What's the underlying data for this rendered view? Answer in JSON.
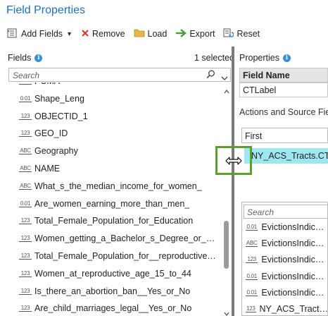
{
  "window": {
    "title": "Field Properties"
  },
  "toolbar": {
    "add_fields": "Add Fields",
    "remove": "Remove",
    "load": "Load",
    "export": "Export",
    "reset": "Reset"
  },
  "fields_panel": {
    "label": "Fields",
    "selected": "1 selected",
    "search_placeholder": "Search",
    "items": [
      {
        "type": "ABC",
        "name": "PUMA"
      },
      {
        "type": "0.01",
        "name": "Shape_Leng"
      },
      {
        "type": "123",
        "name": "OBJECTID_1"
      },
      {
        "type": "123",
        "name": "GEO_ID"
      },
      {
        "type": "ABC",
        "name": "Geography"
      },
      {
        "type": "ABC",
        "name": "NAME"
      },
      {
        "type": "ABC",
        "name": "What_s_the_median_income_for_women_"
      },
      {
        "type": "0.01",
        "name": "Are_women_earning_more_than_men_"
      },
      {
        "type": "123",
        "name": "Total_Female_Population_for_Education"
      },
      {
        "type": "123",
        "name": "Women_getting_a_Bachelor_s_Degree_or_higher"
      },
      {
        "type": "123",
        "name": "Total_Female_Population_for__reproductive_heal..."
      },
      {
        "type": "123",
        "name": "Women_at_reproductive_age_15_to_44"
      },
      {
        "type": "123",
        "name": "Is_there_an_abortion_ban__Yes_or_No"
      },
      {
        "type": "123",
        "name": "Are_child_marriages_legal__Yes_or_No"
      }
    ]
  },
  "properties_panel": {
    "label": "Properties",
    "field_name_header": "Field Name",
    "field_name_value": "CTLabel",
    "actions_label": "Actions and Source Field",
    "action_value": "First",
    "source_field": "NY_ACS_Tracts.CTLabel",
    "search_placeholder": "Search",
    "source_items": [
      {
        "type": "0.01",
        "name": "EvictionsIndicator"
      },
      {
        "type": "ABC",
        "name": "EvictionsIndicator"
      },
      {
        "type": "123",
        "name": "EvictionsIndicator"
      },
      {
        "type": "0.01",
        "name": "EvictionsIndicator"
      },
      {
        "type": "0.01",
        "name": "EvictionsIndicator"
      },
      {
        "type": "123",
        "name": "NY_ACS_Tracts.Area"
      }
    ]
  },
  "colors": {
    "title": "#1e6fbf",
    "source_highlight": "#9ee7ee",
    "annotation_box": "#5aa02c",
    "remove_x": "#d9342b",
    "export_arrow": "#4a9a3a",
    "load_folder": "#e6b84a"
  }
}
